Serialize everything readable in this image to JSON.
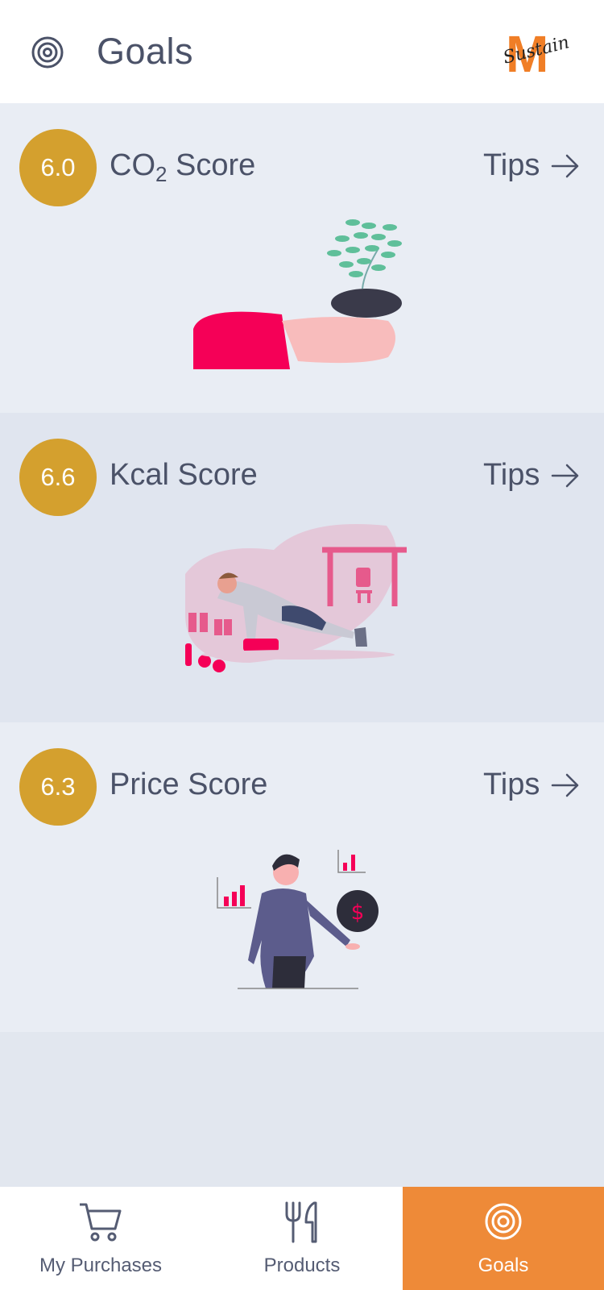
{
  "header": {
    "title": "Goals",
    "icon": "target-icon",
    "logo": {
      "letter": "M",
      "script": "Sustain"
    }
  },
  "cards": [
    {
      "score": "6.0",
      "title_main": "CO",
      "title_sub": "2",
      "title_rest": " Score",
      "tips": "Tips",
      "illustration": "hands-holding-plant"
    },
    {
      "score": "6.6",
      "title": "Kcal Score",
      "tips": "Tips",
      "illustration": "man-doing-pushups"
    },
    {
      "score": "6.3",
      "title": "Price Score",
      "tips": "Tips",
      "illustration": "man-with-coin"
    }
  ],
  "bottom_nav": [
    {
      "label": "My Purchases",
      "icon": "cart-icon",
      "active": false
    },
    {
      "label": "Products",
      "icon": "cutlery-icon",
      "active": false
    },
    {
      "label": "Goals",
      "icon": "target-icon",
      "active": true
    }
  ],
  "colors": {
    "badge": "#d4a02e",
    "accent": "#ee8a38",
    "brand": "#f07e26",
    "text": "#4b5268"
  }
}
